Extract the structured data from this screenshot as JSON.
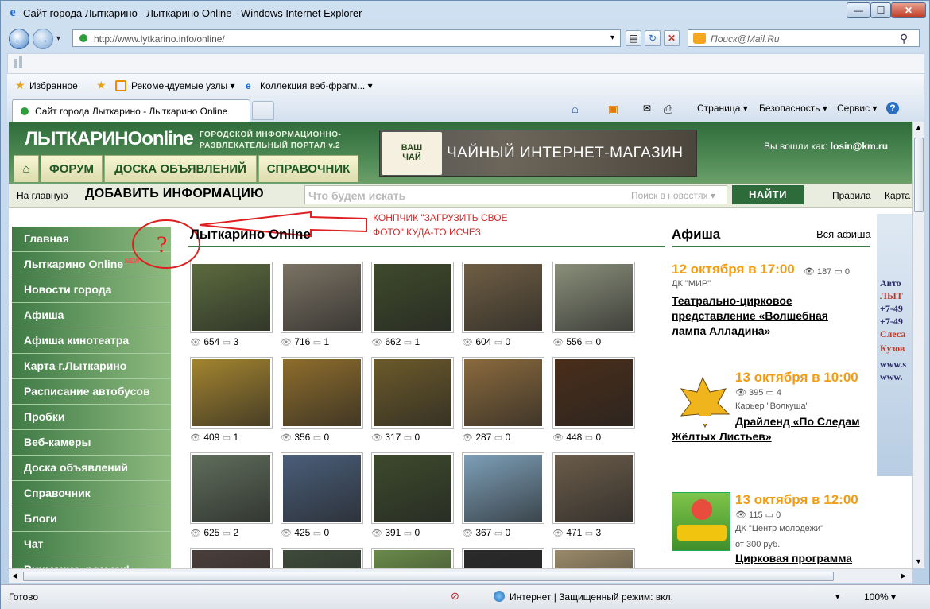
{
  "window": {
    "title": "Сайт города Лыткарино - Лыткарино Online - Windows Internet Explorer",
    "minimize": "—",
    "maximize": "☐",
    "close": "✕"
  },
  "address": {
    "url": "http://www.lytkarino.info/online/",
    "search_placeholder": "Поиск@Mail.Ru"
  },
  "favorites_bar": {
    "favorites": "Избранное",
    "recommended": "Рекомендуемые узлы ▾",
    "collection": "Коллекция веб-фрагм... ▾"
  },
  "tab": {
    "label": "Сайт города Лыткарино - Лыткарино Online"
  },
  "commands": {
    "page": "Страница ▾",
    "security": "Безопасность ▾",
    "service": "Сервис ▾",
    "help": "?"
  },
  "site": {
    "logo": "ЛЫТКАРИНОonline",
    "logo_sub": "ГОРОДСКОЙ ИНФОРМАЦИОННО-РАЗВЛЕКАТЕЛЬНЫЙ ПОРТАЛ v.2",
    "banner_logo": "ВАШ ЧАЙ",
    "banner_text": "ЧАЙНЫЙ ИНТЕРНЕТ-МАГАЗИН",
    "login_label": "Вы вошли как:",
    "login_user": "losin@km.ru",
    "tabs": [
      "ФОРУМ",
      "ДОСКА ОБЪЯВЛЕНИЙ",
      "СПРАВОЧНИК"
    ],
    "home_icon": "⌂"
  },
  "strip": {
    "home": "На главную",
    "add": "ДОБАВИТЬ ИНФОРМАЦИЮ",
    "search_placeholder": "Что будем искать",
    "search_scope": "Поиск в новостях ▾",
    "find": "НАЙТИ",
    "rules": "Правила",
    "map": "Карта"
  },
  "sidebar": {
    "items": [
      "Главная",
      "Лыткарино Online",
      "Новости города",
      "Афиша",
      "Афиша кинотеатра",
      "Карта г.Лыткарино",
      "Расписание автобусов",
      "Пробки",
      "Веб-камеры",
      "Доска объявлений",
      "Справочник",
      "Блоги",
      "Чат",
      "Внимание, розыск!"
    ],
    "new_badge": "NEW"
  },
  "center": {
    "title": "Лыткарино Online",
    "photos": [
      {
        "views": "654",
        "comments": "3",
        "color": "#5c6b3e"
      },
      {
        "views": "716",
        "comments": "1",
        "color": "#7b7364"
      },
      {
        "views": "662",
        "comments": "1",
        "color": "#3f4a2b"
      },
      {
        "views": "604",
        "comments": "0",
        "color": "#6f5e44"
      },
      {
        "views": "556",
        "comments": "0",
        "color": "#8a8f7a"
      },
      {
        "views": "409",
        "comments": "1",
        "color": "#a3842f"
      },
      {
        "views": "356",
        "comments": "0",
        "color": "#8e6d2c"
      },
      {
        "views": "317",
        "comments": "0",
        "color": "#6b5a2a"
      },
      {
        "views": "287",
        "comments": "0",
        "color": "#8a6a3d"
      },
      {
        "views": "448",
        "comments": "0",
        "color": "#4a2e1a"
      },
      {
        "views": "625",
        "comments": "2",
        "color": "#5f6d5b"
      },
      {
        "views": "425",
        "comments": "0",
        "color": "#4a5e7a"
      },
      {
        "views": "391",
        "comments": "0",
        "color": "#3d4a2c"
      },
      {
        "views": "367",
        "comments": "0",
        "color": "#7d9fb8"
      },
      {
        "views": "471",
        "comments": "3",
        "color": "#6b5c4a"
      },
      {
        "views": "",
        "comments": "",
        "color": "#4a3e3a"
      },
      {
        "views": "",
        "comments": "",
        "color": "#3e4a3a"
      },
      {
        "views": "",
        "comments": "",
        "color": "#6a8a4a"
      },
      {
        "views": "",
        "comments": "",
        "color": "#2a2a2a"
      },
      {
        "views": "",
        "comments": "",
        "color": "#9a8a6a"
      }
    ]
  },
  "afisha": {
    "title": "Афиша",
    "all": "Вся афиша",
    "events": [
      {
        "date": "12 октября в 17:00",
        "views": "187",
        "comments": "0",
        "place": "ДК \"МИР\"",
        "price": "",
        "name": "Театрально-цирковое представление «Волшебная лампа Алладина»"
      },
      {
        "date": "13 октября в 10:00",
        "views": "395",
        "comments": "4",
        "place": "Карьер \"Волкуша\"",
        "price": "",
        "name": "Драйленд «По Следам Жёлтых Листьев»"
      },
      {
        "date": "13 октября в 12:00",
        "views": "115",
        "comments": "0",
        "place": "ДК \"Центр молодежи\"",
        "price": "от 300 руб.",
        "name": "Цирковая программа"
      }
    ]
  },
  "ad": {
    "lines": [
      "Авто",
      "ЛЫТ",
      "+7-49",
      "+7-49",
      "Слеса",
      "Кузов",
      "www.s",
      "www."
    ]
  },
  "annotation": {
    "line1": "КОНПЧИК \"ЗАГРУЗИТЬ СВОЕ",
    "line2": "ФОТО\" КУДА-ТО ИСЧЕЗ",
    "mark": "?"
  },
  "status": {
    "text": "Готово",
    "zone": "Интернет | Защищенный режим: вкл.",
    "zoom": "100% ▾"
  },
  "colors": {
    "site_green": "#2f6c3b",
    "date_orange": "#f39c12",
    "annotation_red": "#d42a2a"
  }
}
